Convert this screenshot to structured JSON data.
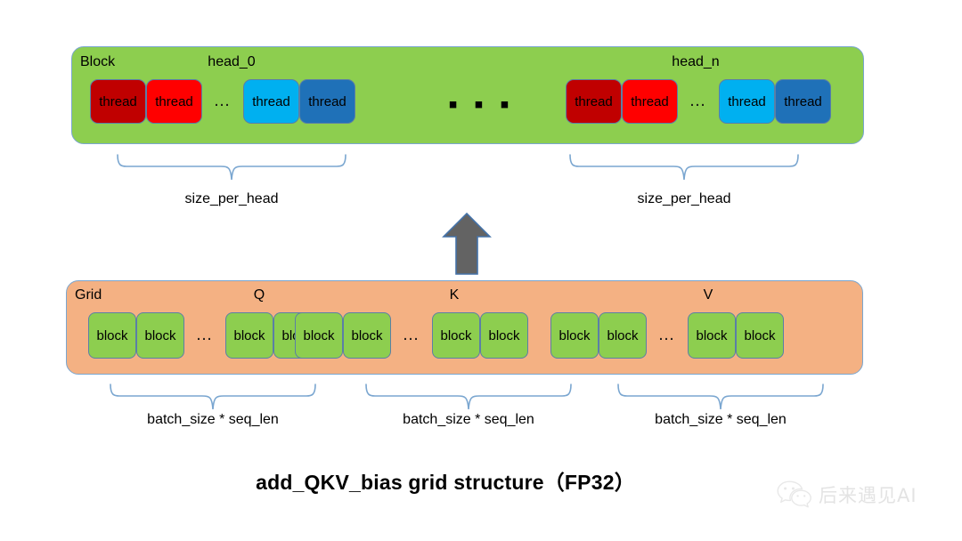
{
  "diagram": {
    "title": "add_QKV_bias grid structure（FP32）",
    "colors": {
      "block_background": "#8DCE4F",
      "grid_background": "#F4B183",
      "thread_dark_red": "#C00000",
      "thread_red": "#FF0000",
      "thread_cyan": "#00B0F0",
      "thread_blue": "#1F71B8",
      "brace_stroke": "#7AA6D0",
      "arrow_fill": "#636363",
      "arrow_stroke": "#4472A8"
    }
  },
  "block_row": {
    "label": "Block",
    "center_ellipsis": "▪ ▪ ▪",
    "heads": [
      {
        "name": "head_0",
        "threads": [
          {
            "label": "thread",
            "color_key": "thread_dark_red"
          },
          {
            "label": "thread",
            "color_key": "thread_red"
          },
          {
            "label": "…",
            "color_key": "ellipsis"
          },
          {
            "label": "thread",
            "color_key": "thread_cyan"
          },
          {
            "label": "thread",
            "color_key": "thread_blue"
          }
        ],
        "brace_caption": "size_per_head"
      },
      {
        "name": "head_n",
        "threads": [
          {
            "label": "thread",
            "color_key": "thread_dark_red"
          },
          {
            "label": "thread",
            "color_key": "thread_red"
          },
          {
            "label": "…",
            "color_key": "ellipsis"
          },
          {
            "label": "thread",
            "color_key": "thread_cyan"
          },
          {
            "label": "thread",
            "color_key": "thread_blue"
          }
        ],
        "brace_caption": "size_per_head"
      }
    ]
  },
  "grid_row": {
    "label": "Grid",
    "sections": [
      {
        "name": "Q",
        "blocks": [
          "block",
          "block",
          "…",
          "block",
          "block"
        ],
        "brace_caption": "batch_size * seq_len"
      },
      {
        "name": "K",
        "blocks": [
          "block",
          "block",
          "…",
          "block",
          "block"
        ],
        "brace_caption": "batch_size * seq_len"
      },
      {
        "name": "V",
        "blocks": [
          "block",
          "block",
          "…",
          "block",
          "block"
        ],
        "brace_caption": "batch_size * seq_len"
      }
    ]
  },
  "arrow": {
    "direction": "up",
    "name": "grid-to-block-arrow"
  },
  "watermark": {
    "text": "后来遇见AI",
    "icon": "wechat-icon"
  }
}
